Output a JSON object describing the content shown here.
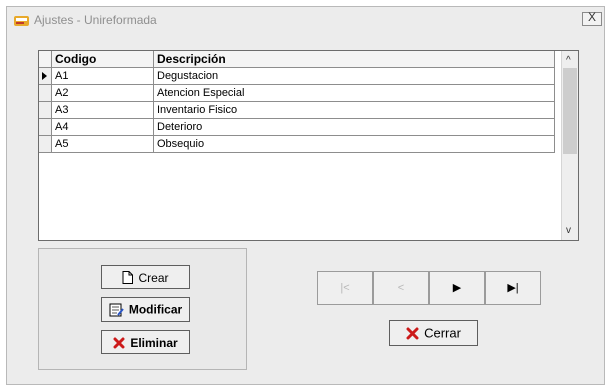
{
  "window": {
    "title": "Ajustes - Unireformada",
    "close_label": "X"
  },
  "grid": {
    "headers": [
      "Codigo",
      "Descripción"
    ],
    "rows": [
      [
        "A1",
        "Degustacion"
      ],
      [
        "A2",
        "Atencion Especial"
      ],
      [
        "A3",
        "Inventario Fisico"
      ],
      [
        "A4",
        "Deterioro"
      ],
      [
        "A5",
        "Obsequio"
      ]
    ],
    "scroll_up": "^",
    "scroll_down": "v"
  },
  "buttons": {
    "crear": "Crear",
    "modificar": "Modificar",
    "eliminar": "Eliminar",
    "cerrar": "Cerrar"
  },
  "nav": {
    "first": "|<",
    "prev": "<",
    "next": "▶",
    "last": "▶|"
  },
  "icons": [
    "app-icon",
    "close-icon",
    "new-document-icon",
    "edit-document-icon",
    "delete-x-icon",
    "record-pointer-icon"
  ],
  "colors": {
    "delete_red": "#cc1a1a",
    "grid_border": "#8d8d8d",
    "window_bg": "#ececec"
  }
}
